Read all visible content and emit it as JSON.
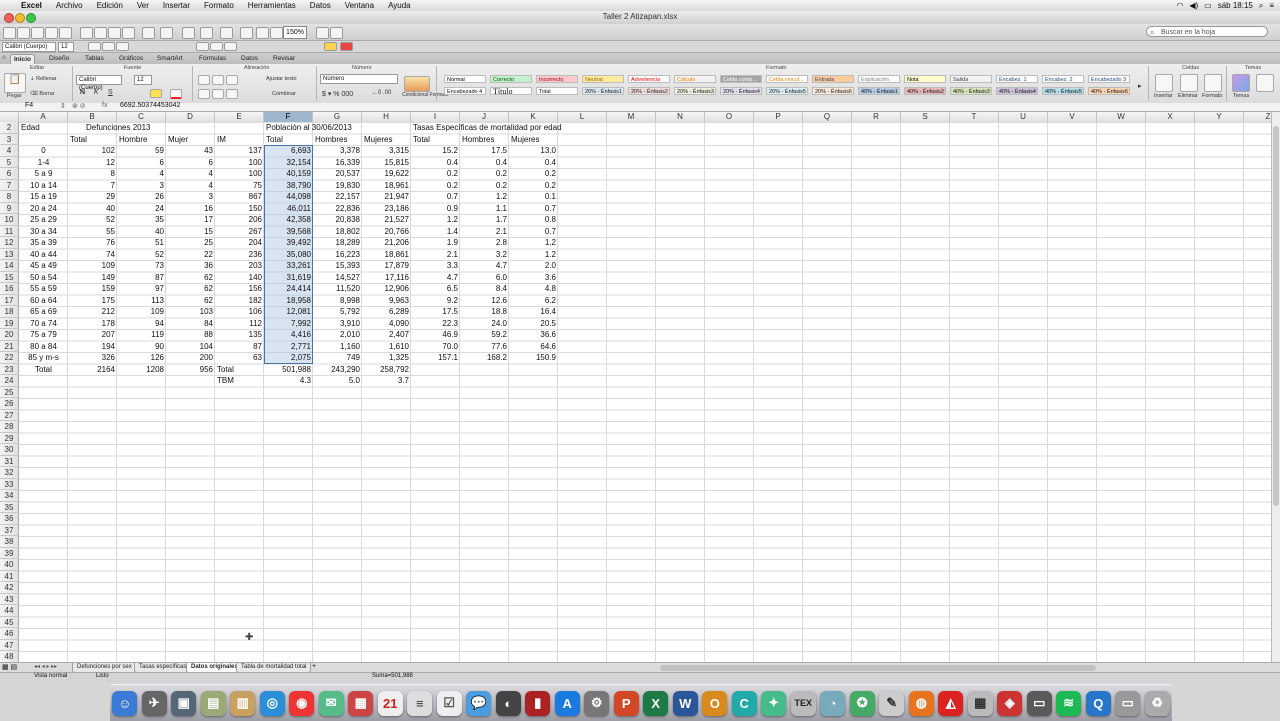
{
  "menubar": {
    "items": [
      "Excel",
      "Archivo",
      "Edición",
      "Ver",
      "Insertar",
      "Formato",
      "Herramientas",
      "Datos",
      "Ventana",
      "Ayuda"
    ],
    "clock": "sáb 18:15"
  },
  "window": {
    "title": "Taller 2 Atizapan.xlsx"
  },
  "toolbar": {
    "zoom": "150%",
    "search_placeholder": "Buscar en la hoja"
  },
  "formatbar": {
    "font": "Calibri (Cuerpo)",
    "size": "12"
  },
  "ribbon": {
    "tabs": [
      "Inicio",
      "Diseño",
      "Tablas",
      "Gráficos",
      "SmartArt",
      "Fórmulas",
      "Datos",
      "Revisar"
    ],
    "active_tab": "Inicio",
    "groups": [
      "Editar",
      "Fuente",
      "Alineación",
      "Número",
      "Formato",
      "Celdas",
      "Temas"
    ],
    "paste": "Pegar",
    "fill": "Rellenar",
    "clear": "Borrar",
    "font": "Calibri (Cuerpo)",
    "size": "12",
    "wrap": "Ajustar texto",
    "merge": "Combinar",
    "number_format": "Número",
    "conditional": "Condicional Formato",
    "styles_row1": [
      "Normal",
      "Correcto",
      "Incorrecto",
      "Neutral",
      "Advertencia",
      "Cálculo",
      "Celda comp...",
      "Celda vincul...",
      "Entrada",
      "Explicación",
      "Nota",
      "Salida",
      "Encabez. 1",
      "Encabez. 2",
      "Encabezado 3"
    ],
    "styles_row2": [
      "Encabezado 4",
      "Título",
      "Total",
      "20% - Énfasis1",
      "20% - Énfasis2",
      "20% - Énfasis3",
      "20% - Énfasis4",
      "20% - Énfasis5",
      "20% - Énfasis6",
      "40% - Énfasis1",
      "40% - Énfasis2",
      "40% - Énfasis3",
      "40% - Énfasis4",
      "40% - Énfasis5",
      "40% - Énfasis6"
    ],
    "cells_buttons": [
      "Insertar",
      "Eliminar",
      "Formato"
    ],
    "themes": "Temas"
  },
  "formula": {
    "cell_ref": "F4",
    "value": "6692.50374453042"
  },
  "grid": {
    "columns": [
      "A",
      "B",
      "C",
      "D",
      "E",
      "F",
      "G",
      "H",
      "I",
      "J",
      "K",
      "L",
      "M",
      "N",
      "O",
      "P",
      "Q",
      "R",
      "S",
      "T",
      "U",
      "V",
      "W",
      "X",
      "Y",
      "Z"
    ],
    "selected_column": "F",
    "first_row": 2,
    "last_row": 48,
    "headers": {
      "edad": "Edad",
      "defunciones": "Defunciones 2013",
      "poblacion": "Población al 30/06/2013",
      "tasas": "Tasas Específicas de mortalidad por edad",
      "total": "Total",
      "hombre": "Hombre",
      "mujer": "Mujer",
      "im": "IM",
      "hombres": "Hombres",
      "mujeres": "Mujeres"
    },
    "rows": [
      [
        "0",
        "102",
        "59",
        "43",
        "137",
        "6,693",
        "3,378",
        "3,315",
        "15.2",
        "17.5",
        "13.0"
      ],
      [
        "1-4",
        "12",
        "6",
        "6",
        "100",
        "32,154",
        "16,339",
        "15,815",
        "0.4",
        "0.4",
        "0.4"
      ],
      [
        "5 a 9",
        "8",
        "4",
        "4",
        "100",
        "40,159",
        "20,537",
        "19,622",
        "0.2",
        "0.2",
        "0.2"
      ],
      [
        "10 a 14",
        "7",
        "3",
        "4",
        "75",
        "38,790",
        "19,830",
        "18,961",
        "0.2",
        "0.2",
        "0.2"
      ],
      [
        "15 a 19",
        "29",
        "26",
        "3",
        "867",
        "44,098",
        "22,157",
        "21,947",
        "0.7",
        "1.2",
        "0.1"
      ],
      [
        "20 a 24",
        "40",
        "24",
        "16",
        "150",
        "46,011",
        "22,836",
        "23,186",
        "0.9",
        "1.1",
        "0.7"
      ],
      [
        "25 a 29",
        "52",
        "35",
        "17",
        "206",
        "42,358",
        "20,838",
        "21,527",
        "1.2",
        "1.7",
        "0.8"
      ],
      [
        "30 a 34",
        "55",
        "40",
        "15",
        "267",
        "39,568",
        "18,802",
        "20,766",
        "1.4",
        "2.1",
        "0.7"
      ],
      [
        "35 a 39",
        "76",
        "51",
        "25",
        "204",
        "39,492",
        "18,289",
        "21,206",
        "1.9",
        "2.8",
        "1.2"
      ],
      [
        "40 a 44",
        "74",
        "52",
        "22",
        "236",
        "35,080",
        "16,223",
        "18,861",
        "2.1",
        "3.2",
        "1.2"
      ],
      [
        "45 a 49",
        "109",
        "73",
        "36",
        "203",
        "33,261",
        "15,393",
        "17,879",
        "3.3",
        "4.7",
        "2.0"
      ],
      [
        "50 a 54",
        "149",
        "87",
        "62",
        "140",
        "31,619",
        "14,527",
        "17,116",
        "4.7",
        "6.0",
        "3.6"
      ],
      [
        "55 a 59",
        "159",
        "97",
        "62",
        "156",
        "24,414",
        "11,520",
        "12,906",
        "6.5",
        "8.4",
        "4.8"
      ],
      [
        "60 a 64",
        "175",
        "113",
        "62",
        "182",
        "18,958",
        "8,998",
        "9,963",
        "9.2",
        "12.6",
        "6.2"
      ],
      [
        "65 a 69",
        "212",
        "109",
        "103",
        "106",
        "12,081",
        "5,792",
        "6,289",
        "17.5",
        "18.8",
        "16.4"
      ],
      [
        "70 a 74",
        "178",
        "94",
        "84",
        "112",
        "7,992",
        "3,910",
        "4,090",
        "22.3",
        "24.0",
        "20.5"
      ],
      [
        "75 a 79",
        "207",
        "119",
        "88",
        "135",
        "4,416",
        "2,010",
        "2,407",
        "46.9",
        "59.2",
        "36.6"
      ],
      [
        "80 a 84",
        "194",
        "90",
        "104",
        "87",
        "2,771",
        "1,160",
        "1,610",
        "70.0",
        "77.6",
        "64.6"
      ],
      [
        "85 y m-s",
        "326",
        "126",
        "200",
        "63",
        "2,075",
        "749",
        "1,325",
        "157.1",
        "168.2",
        "150.9"
      ]
    ],
    "total_row": {
      "label": "Total",
      "b": "2164",
      "c": "1208",
      "d": "956",
      "e": "Total",
      "f": "501,988",
      "g": "243,290",
      "h": "258,792"
    },
    "tbm_row": {
      "label": "TBM",
      "f": "4.3",
      "g": "5.0",
      "h": "3.7"
    }
  },
  "sheets": [
    "Defunciones por sex",
    "Tasas específicas",
    "Datos originales",
    "Tabla de mortalidad total"
  ],
  "active_sheet": "Datos originales",
  "status": {
    "view": "Vista normal",
    "ready": "Listo",
    "sum": "Suma=501,988"
  }
}
